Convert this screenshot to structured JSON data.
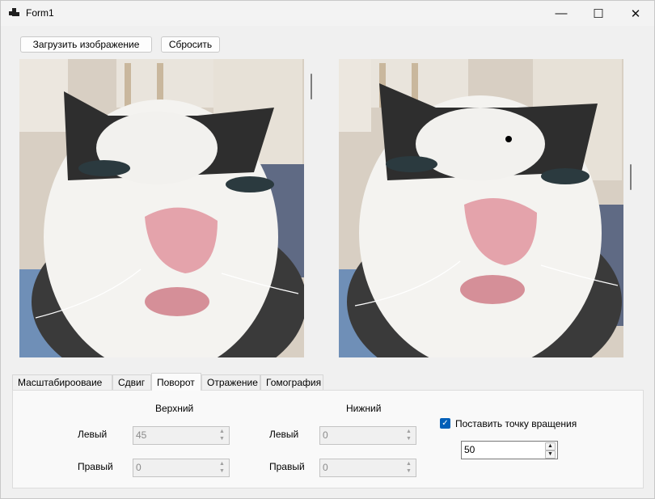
{
  "window": {
    "title": "Form1",
    "minimize": "—",
    "maximize": "☐",
    "close": "✕"
  },
  "toolbar": {
    "load_label": "Загрузить изображение",
    "reset_label": "Сбросить"
  },
  "tabs": [
    {
      "label": "Масштабирооваие"
    },
    {
      "label": "Сдвиг"
    },
    {
      "label": "Поворот"
    },
    {
      "label": "Отражение"
    },
    {
      "label": "Гомография"
    }
  ],
  "rotation": {
    "top_header": "Верхний",
    "bottom_header": "Нижний",
    "top_left_label": "Левый",
    "top_left_value": "45",
    "top_right_label": "Правый",
    "top_right_value": "0",
    "bottom_left_label": "Левый",
    "bottom_left_value": "0",
    "bottom_right_label": "Правый",
    "bottom_right_value": "0",
    "pivot_checkbox_label": "Поставить точку вращения",
    "pivot_checked": true,
    "pivot_value": "50"
  },
  "colors": {
    "accent": "#005fb8",
    "window_bg": "#f0f0f0"
  }
}
